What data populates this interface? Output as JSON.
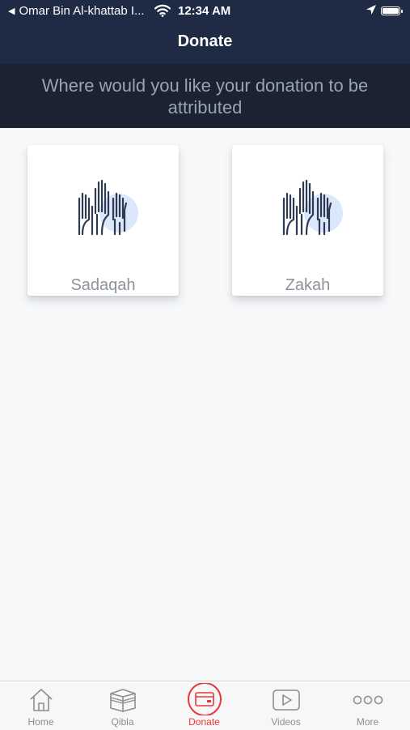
{
  "status_bar": {
    "carrier": "Omar Bin Al-khattab I...",
    "time": "12:34 AM"
  },
  "header": {
    "title": "Donate",
    "subtitle": "Where would you like your donation to be attributed"
  },
  "options": [
    {
      "label": "Sadaqah",
      "icon": "raised-hands-icon"
    },
    {
      "label": "Zakah",
      "icon": "raised-hands-icon"
    }
  ],
  "tabs": [
    {
      "label": "Home",
      "icon": "home-icon"
    },
    {
      "label": "Qibla",
      "icon": "kaaba-icon"
    },
    {
      "label": "Donate",
      "icon": "card-icon",
      "active": true
    },
    {
      "label": "Videos",
      "icon": "play-icon"
    },
    {
      "label": "More",
      "icon": "more-icon"
    }
  ],
  "colors": {
    "nav_bg": "#1f2b44",
    "subheader_bg": "#1b2333",
    "accent": "#e8383d",
    "icon_blob": "#dbe8fb"
  }
}
